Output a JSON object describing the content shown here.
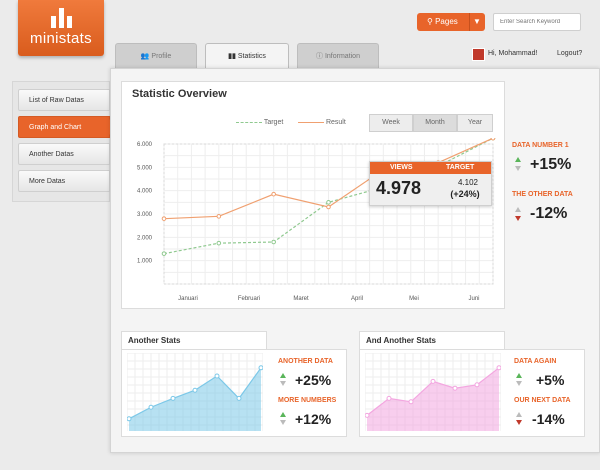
{
  "app": {
    "name": "ministats"
  },
  "header": {
    "pages_label": "Pages",
    "search_placeholder": "Enter Search Keyword",
    "greeting": "Hi, Mohammad!",
    "logout": "Logout?"
  },
  "tabs": [
    {
      "label": "Profile",
      "icon": "users-icon"
    },
    {
      "label": "Statistics",
      "icon": "bar-chart-icon",
      "active": true
    },
    {
      "label": "Information",
      "icon": "info-icon"
    }
  ],
  "sidebar": {
    "items": [
      {
        "label": "List of Raw Datas"
      },
      {
        "label": "Graph and Chart",
        "active": true
      },
      {
        "label": "Another Datas"
      },
      {
        "label": "More Datas"
      }
    ]
  },
  "overview": {
    "title": "Statistic Overview",
    "legend": {
      "target": "Target",
      "result": "Result"
    },
    "periods": [
      "Week",
      "Month",
      "Year"
    ],
    "selected_period": "Month",
    "tooltip": {
      "views_label": "VIEWS",
      "target_label": "TARGET",
      "views_value": "4.978",
      "target_value": "4.102",
      "target_change": "(+24%)"
    }
  },
  "side_stats": [
    {
      "label": "DATA NUMBER 1",
      "value": "+15%",
      "trend": "up"
    },
    {
      "label": "THE OTHER DATA",
      "value": "-12%",
      "trend": "down"
    }
  ],
  "another_stats": {
    "title": "Another Stats",
    "stats": [
      {
        "label": "ANOTHER DATA",
        "value": "+25%",
        "trend": "up"
      },
      {
        "label": "MORE NUMBERS",
        "value": "+12%",
        "trend": "up"
      }
    ]
  },
  "and_another_stats": {
    "title": "And Another Stats",
    "stats": [
      {
        "label": "DATA AGAIN",
        "value": "+5%",
        "trend": "up"
      },
      {
        "label": "OUR NEXT DATA",
        "value": "-14%",
        "trend": "down"
      }
    ]
  },
  "colors": {
    "accent": "#e8642a",
    "result_line": "#f0a070",
    "target_line": "#8fc98f",
    "up": "#5ab55a",
    "down": "#c0392b",
    "mini_blue": "#7cc8e8",
    "mini_pink": "#f3a6e0"
  },
  "chart_data": [
    {
      "type": "line",
      "categories": [
        "Januari",
        "Februari",
        "Maret",
        "April",
        "Mei",
        "Juni"
      ],
      "ylim": [
        0,
        6000
      ],
      "yticks": [
        "1.000",
        "2.000",
        "3.000",
        "4.000",
        "5.000",
        "6.000"
      ],
      "series": [
        {
          "name": "Target",
          "values": [
            1300,
            1750,
            1800,
            3500,
            4150,
            5050,
            6250
          ]
        },
        {
          "name": "Result",
          "values": [
            2800,
            2900,
            3850,
            3300,
            4900,
            5200,
            6250
          ]
        }
      ]
    },
    {
      "type": "area",
      "values": [
        15,
        32,
        45,
        57,
        78,
        45,
        90
      ]
    },
    {
      "type": "area",
      "values": [
        20,
        45,
        40,
        70,
        60,
        65,
        90
      ]
    }
  ]
}
